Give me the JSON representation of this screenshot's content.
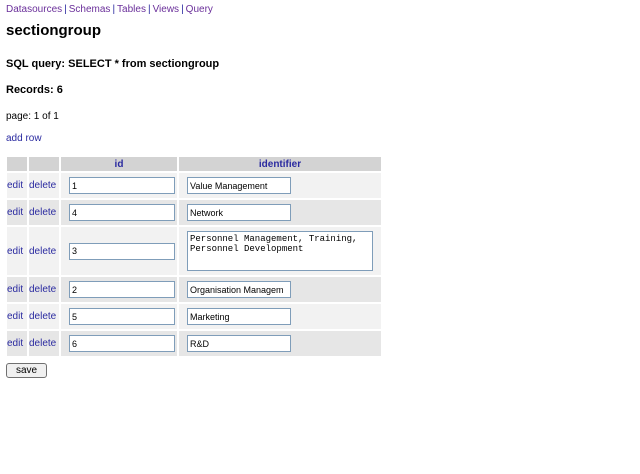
{
  "nav": {
    "links": [
      "Datasources",
      "Schemas",
      "Tables",
      "Views",
      "Query"
    ],
    "separator": "|"
  },
  "title": "sectiongroup",
  "sql_label": "SQL query: SELECT * from sectiongroup",
  "records_label": "Records: 6",
  "page_label": "page: 1 of 1",
  "add_row_label": "add row",
  "columns": {
    "id": "id",
    "identifier": "identifier"
  },
  "actions": {
    "edit": "edit",
    "delete": "delete"
  },
  "rows": [
    {
      "id": "1",
      "identifier": "Value Management"
    },
    {
      "id": "4",
      "identifier": "Network"
    },
    {
      "id": "3",
      "identifier": "Personnel Management, Training,\nPersonnel Development"
    },
    {
      "id": "2",
      "identifier": "Organisation Managem"
    },
    {
      "id": "5",
      "identifier": "Marketing"
    },
    {
      "id": "6",
      "identifier": "R&D"
    }
  ],
  "save_label": "save"
}
